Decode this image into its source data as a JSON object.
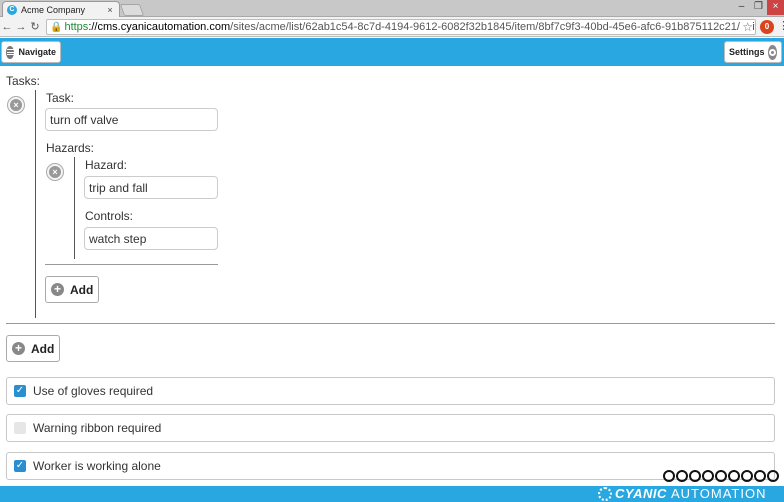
{
  "browser": {
    "tab_title": "Acme Company",
    "tab_close": "×",
    "url_scheme": "https",
    "url_domain": "://cms.cyanicautomation.com",
    "url_path": "/sites/acme/list/62ab1c54-8c7d-4194-9612-6082f32b1845/item/8bf7c9f3-40bd-45e6-afc6-91b875112c21/edit?source",
    "min": "–",
    "restore": "❐",
    "close": "×",
    "ext_label": "0"
  },
  "header": {
    "navigate_label": "Navigate",
    "settings_label": "Settings"
  },
  "form": {
    "tasks_label": "Tasks:",
    "task_label": "Task:",
    "task_value": "turn off valve",
    "hazards_label": "Hazards:",
    "hazard_label": "Hazard:",
    "hazard_value": "trip and fall",
    "controls_label": "Controls:",
    "controls_value": "watch step",
    "add_hazard_label": "Add",
    "add_task_label": "Add",
    "checks": [
      {
        "label": "Use of gloves required",
        "checked": true
      },
      {
        "label": "Warning ribbon required",
        "checked": false
      },
      {
        "label": "Worker is working alone",
        "checked": true
      }
    ]
  },
  "footer": {
    "brand_main": "CYANIC",
    "brand_sub": "AUTOMATION"
  },
  "colors": {
    "accent": "#29a7e1",
    "checkbox_on": "#2a8fd1"
  }
}
